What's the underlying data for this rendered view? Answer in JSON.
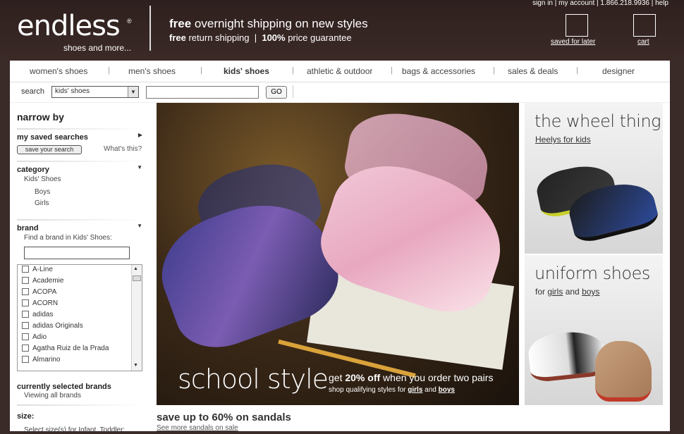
{
  "header": {
    "logo_text": "endless",
    "logo_reg": "®",
    "logo_sub": "shoes and more...",
    "promo_bold": "free",
    "promo_text": " overnight shipping on new styles",
    "promo2_a_bold": "free",
    "promo2_a": " return shipping",
    "promo2_sep": "|",
    "promo2_b_bold": "100%",
    "promo2_b": " price guarantee",
    "utility": "sign in | my account | 1.866.218.9936 | help",
    "saved_label": "saved for later",
    "cart_label": "cart"
  },
  "nav": {
    "items": [
      "women's shoes",
      "men's shoes",
      "kids' shoes",
      "athletic & outdoor",
      "bags & accessories",
      "sales & deals",
      "designer"
    ],
    "sep": "|"
  },
  "search": {
    "label": "search",
    "select_value": "kids' shoes",
    "go": "GO"
  },
  "sidebar": {
    "narrow_by": "narrow by",
    "saved_searches": "my saved searches",
    "save_search_btn": "save your search",
    "whats_this": "What's this?",
    "category": "category",
    "category_parent": "Kids' Shoes",
    "category_items": [
      "Boys",
      "Girls"
    ],
    "brand": "brand",
    "brand_prompt": "Find a brand in Kids' Shoes:",
    "brands": [
      "A-Line",
      "Academie",
      "ACOPA",
      "ACORN",
      "adidas",
      "adidas Originals",
      "Adio",
      "Agatha Ruiz de la Prada",
      "Almarino"
    ],
    "selected_brands": "currently selected brands",
    "viewing_all": "Viewing all brands",
    "size": "size:",
    "size_prompt": "Select size(s) for Infant, Toddler:"
  },
  "hero": {
    "title": "school style",
    "offer_pre": "get ",
    "offer_bold": "20% off",
    "offer_post": " when you order two pairs",
    "sub_pre": "shop qualifying styles for ",
    "sub_girls": "girls",
    "sub_and": " and ",
    "sub_boys": "boys"
  },
  "panels": {
    "wheel_title": "the wheel thing",
    "wheel_sub": "Heelys for kids",
    "uniform_title": "uniform shoes",
    "uniform_sub_pre": "for ",
    "uniform_girls": "girls",
    "uniform_and": " and ",
    "uniform_boys": "boys"
  },
  "bottom": {
    "sandals_title": "save up to 60% on sandals",
    "sandals_link": "See more sandals on sale"
  }
}
